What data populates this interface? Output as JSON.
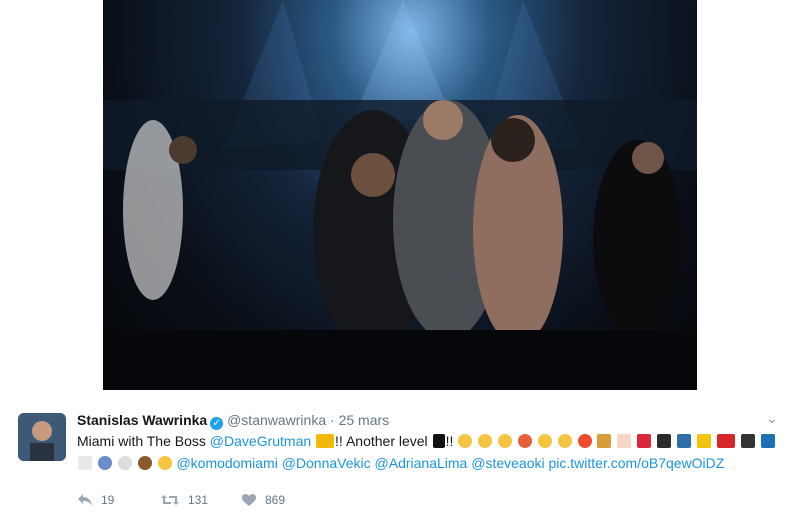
{
  "tweet": {
    "author_name": "Stanislas Wawrinka",
    "handle": "@stanwawrinka",
    "dot": "·",
    "date": "25 mars",
    "text_part1": "Miami with The Boss",
    "mention_dave": "@DaveGrutman",
    "text_part2": "!! Another level",
    "text_part3": "!!",
    "mention_komodo": "@komodomiami",
    "mention_donna": "@DonnaVekic",
    "mention_adriana": "@AdrianaLima",
    "mention_steve": "@steveaoki",
    "pic_link": "pic.twitter.com/oB7qewOiDZ"
  },
  "actions": {
    "reply_count": "19",
    "retweet_count": "131",
    "like_count": "869"
  },
  "icons": {
    "menu": "chevron-down-icon",
    "reply": "reply-icon",
    "retweet": "retweet-icon",
    "like": "heart-icon",
    "verified": "verified-badge-icon"
  },
  "colors": {
    "link": "#1b95e0",
    "verified": "#1da1f2",
    "meta": "#657786"
  }
}
